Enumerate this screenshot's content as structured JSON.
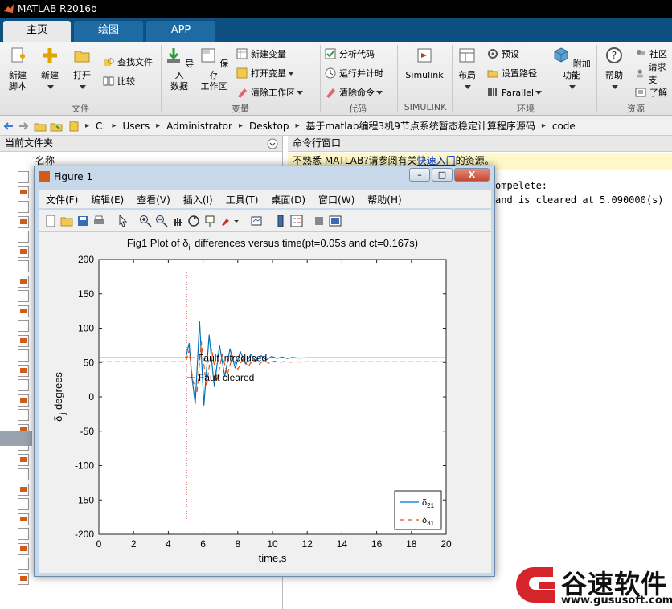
{
  "window": {
    "title": "MATLAB R2016b"
  },
  "tabs": [
    {
      "label": "主页",
      "active": true
    },
    {
      "label": "绘图",
      "active": false
    },
    {
      "label": "APP",
      "active": false
    }
  ],
  "ribbon": {
    "file": {
      "label": "文件",
      "new_script": "新建\n脚本",
      "new": "新建",
      "open": "打开",
      "find_files": "查找文件",
      "compare": "比较"
    },
    "variable": {
      "label": "变量",
      "import": "导入\n数据",
      "save_ws": "保存\n工作区",
      "new_var": "新建变量",
      "open_var": "打开变量",
      "clear_ws": "清除工作区"
    },
    "code": {
      "label": "代码",
      "analyze": "分析代码",
      "run_time": "运行并计时",
      "clear_cmd": "清除命令"
    },
    "simulink": {
      "label": "SIMULINK",
      "button": "Simulink"
    },
    "environment": {
      "label": "环境",
      "layout": "布局",
      "prefs": "预设",
      "set_path": "设置路径",
      "parallel": "Parallel",
      "addons": "附加功能"
    },
    "resources": {
      "label": "资源",
      "help": "帮助",
      "community": "社区",
      "request": "请求支",
      "learn": "了解"
    }
  },
  "address": {
    "path": [
      "C:",
      "Users",
      "Administrator",
      "Desktop",
      "基于matlab编程3机9节点系统暂态稳定计算程序源码",
      "code"
    ]
  },
  "left_panel": {
    "title": "当前文件夹",
    "column": "名称"
  },
  "right_panel": {
    "title": "命令行窗口",
    "notice_prefix": "不熟悉 MATLAB?请参阅有关",
    "notice_link": "快速入门",
    "notice_suffix": "的资源。",
    "lines": [
      "ompelete:",
      "and is cleared at 5.090000(s)"
    ]
  },
  "figure": {
    "title": "Figure 1",
    "menu": [
      "文件(F)",
      "编辑(E)",
      "查看(V)",
      "插入(I)",
      "工具(T)",
      "桌面(D)",
      "窗口(W)",
      "帮助(H)"
    ],
    "win_buttons": {
      "minimize": "–",
      "maximize": "□",
      "close": "X"
    }
  },
  "chart_data": {
    "type": "line",
    "title_prefix": "Fig1 Plot of ",
    "title_sym": "δ",
    "title_sub": "ij",
    "title_suffix": " differences versus time(pt=0.05s and ct=0.167s)",
    "xlabel": "time,s",
    "ylabel_sym": "δ",
    "ylabel_sub": "ij",
    "ylabel_suffix": " degrees",
    "xlim": [
      0,
      20
    ],
    "ylim": [
      -200,
      200
    ],
    "xticks": [
      0,
      2,
      4,
      6,
      8,
      10,
      12,
      14,
      16,
      18,
      20
    ],
    "yticks": [
      200,
      150,
      100,
      50,
      0,
      -50,
      -100,
      -150,
      -200
    ],
    "legend_position": "bottom-right",
    "annotations": [
      {
        "text": "Fault introduced",
        "x": 5.05,
        "y": 57
      },
      {
        "text": "Fault cleared",
        "x": 5.09,
        "y": 28
      }
    ],
    "fault_line_x": 5.05,
    "series": [
      {
        "name_sym": "δ",
        "name_sub": "21",
        "color": "#0072bd",
        "style": "solid",
        "x": [
          0,
          5.0,
          5.2,
          5.35,
          5.55,
          5.8,
          6.05,
          6.35,
          6.65,
          6.95,
          7.25,
          7.55,
          7.85,
          8.15,
          8.45,
          8.75,
          9.05,
          9.35,
          9.65,
          9.95,
          10.25,
          10.55,
          10.85,
          11.15,
          11.5,
          12,
          20
        ],
        "y": [
          57,
          57,
          78,
          30,
          -10,
          110,
          -12,
          90,
          15,
          75,
          30,
          70,
          42,
          66,
          48,
          62,
          52,
          60,
          54,
          59,
          56,
          58,
          56,
          57.5,
          56.5,
          57,
          57
        ]
      },
      {
        "name_sym": "δ",
        "name_sub": "31",
        "color": "#d95319",
        "style": "dashed",
        "x": [
          0,
          5.0,
          5.2,
          5.4,
          5.65,
          5.9,
          6.2,
          6.5,
          6.8,
          7.1,
          7.4,
          7.7,
          8.0,
          8.3,
          8.6,
          8.9,
          9.2,
          9.5,
          9.8,
          10.1,
          10.4,
          10.7,
          11.0,
          11.3,
          11.6,
          12,
          20
        ],
        "y": [
          51,
          51,
          68,
          25,
          5,
          80,
          15,
          70,
          22,
          62,
          32,
          60,
          40,
          56,
          44,
          55,
          47,
          53,
          49,
          52,
          50,
          51.5,
          50.5,
          51,
          50.8,
          51,
          51
        ]
      }
    ]
  },
  "watermark": {
    "brand": "谷速软件",
    "url": "www.gususoft.com"
  }
}
